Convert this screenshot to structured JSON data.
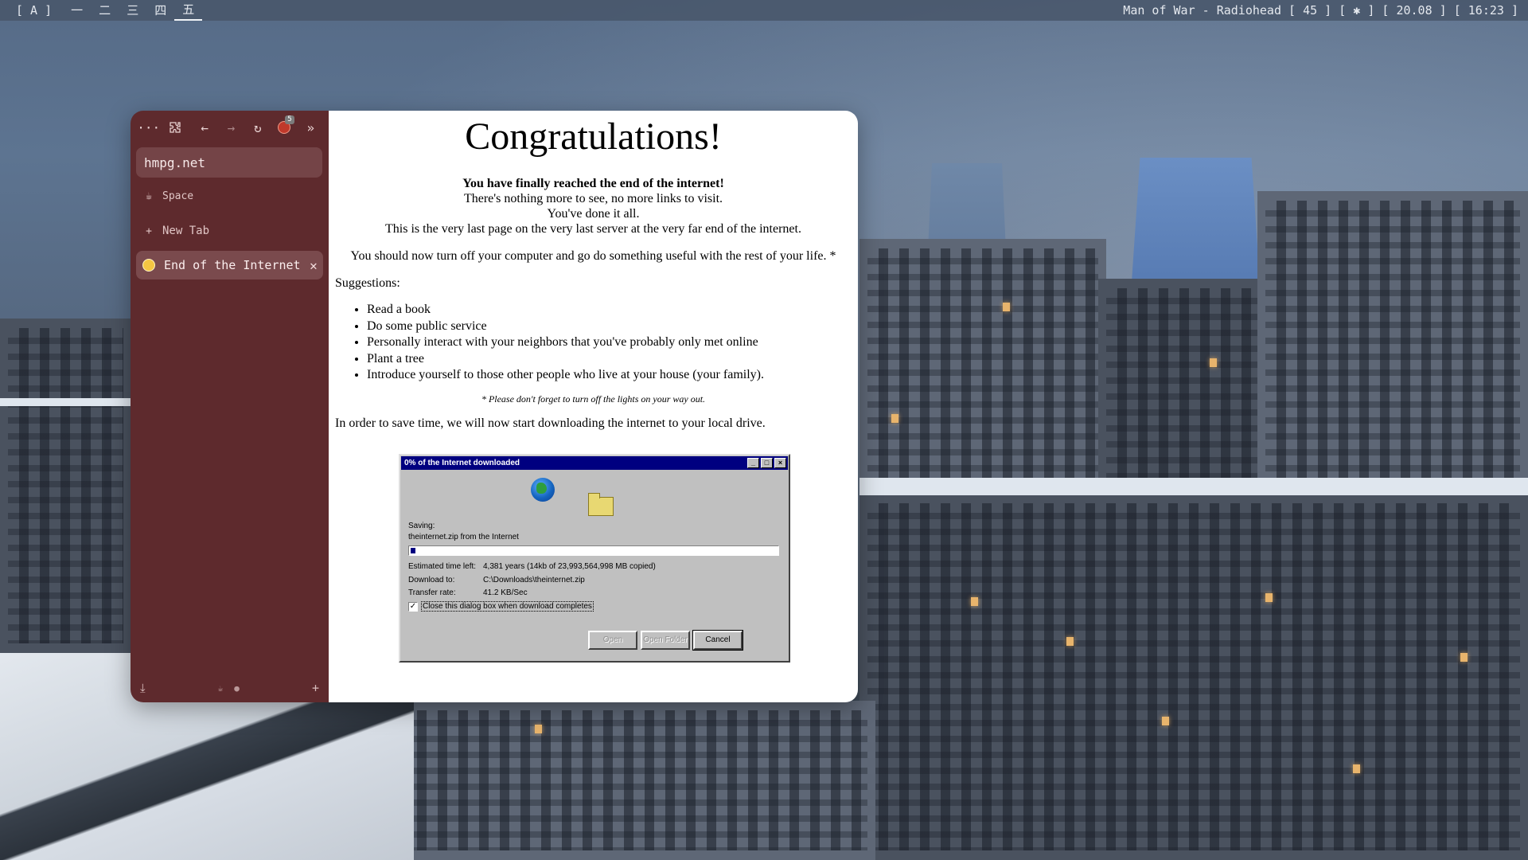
{
  "topbar": {
    "layout_indicator": "[ A ]",
    "workspaces": [
      "一",
      "二",
      "三",
      "四",
      "五"
    ],
    "active_workspace": "五",
    "status": "Man of War - Radiohead [ 45 ] [ ✱ ] [ 20.08 ] [ 16:23 ]"
  },
  "browser": {
    "nav": {
      "menu": "···",
      "ext_badge": "5"
    },
    "url": "hmpg.net",
    "space_label": "Space",
    "new_tab_label": "New Tab",
    "tabs": [
      {
        "title": "End of the Internet"
      }
    ]
  },
  "page": {
    "title": "Congratulations!",
    "lead_bold": "You have finally reached the end of the internet!",
    "lead_lines": [
      "There's nothing more to see, no more links to visit.",
      "You've done it all.",
      "This is the very last page on the very last server at the very far end of the internet."
    ],
    "advice": "You should now turn off your computer and go do something useful with the rest of your life. *",
    "suggestions_label": "Suggestions:",
    "suggestions": [
      "Read a book",
      "Do some public service",
      "Personally interact with your neighbors that you've probably only met online",
      "Plant a tree",
      "Introduce yourself to those other people who live at your house (your family)."
    ],
    "footnote": "* Please don't forget to turn off the lights on your way out.",
    "save_text": "In order to save time, we will now start downloading the internet to your local drive."
  },
  "dialog": {
    "title": "0% of the Internet downloaded",
    "saving_label": "Saving:",
    "saving_file": "theinternet.zip from the Internet",
    "progress_fraction": 0.01,
    "estimated_label": "Estimated time left:",
    "estimated_value": "4,381 years (14kb of 23,993,564,998 MB copied)",
    "download_to_label": "Download to:",
    "download_to_value": "C:\\Downloads\\theinternet.zip",
    "transfer_label": "Transfer rate:",
    "transfer_value": "41.2 KB/Sec",
    "checkbox_label": "Close this dialog box when download completes",
    "checkbox_checked": true,
    "buttons": {
      "open": "Open",
      "open_folder": "Open Folder",
      "cancel": "Cancel"
    }
  }
}
